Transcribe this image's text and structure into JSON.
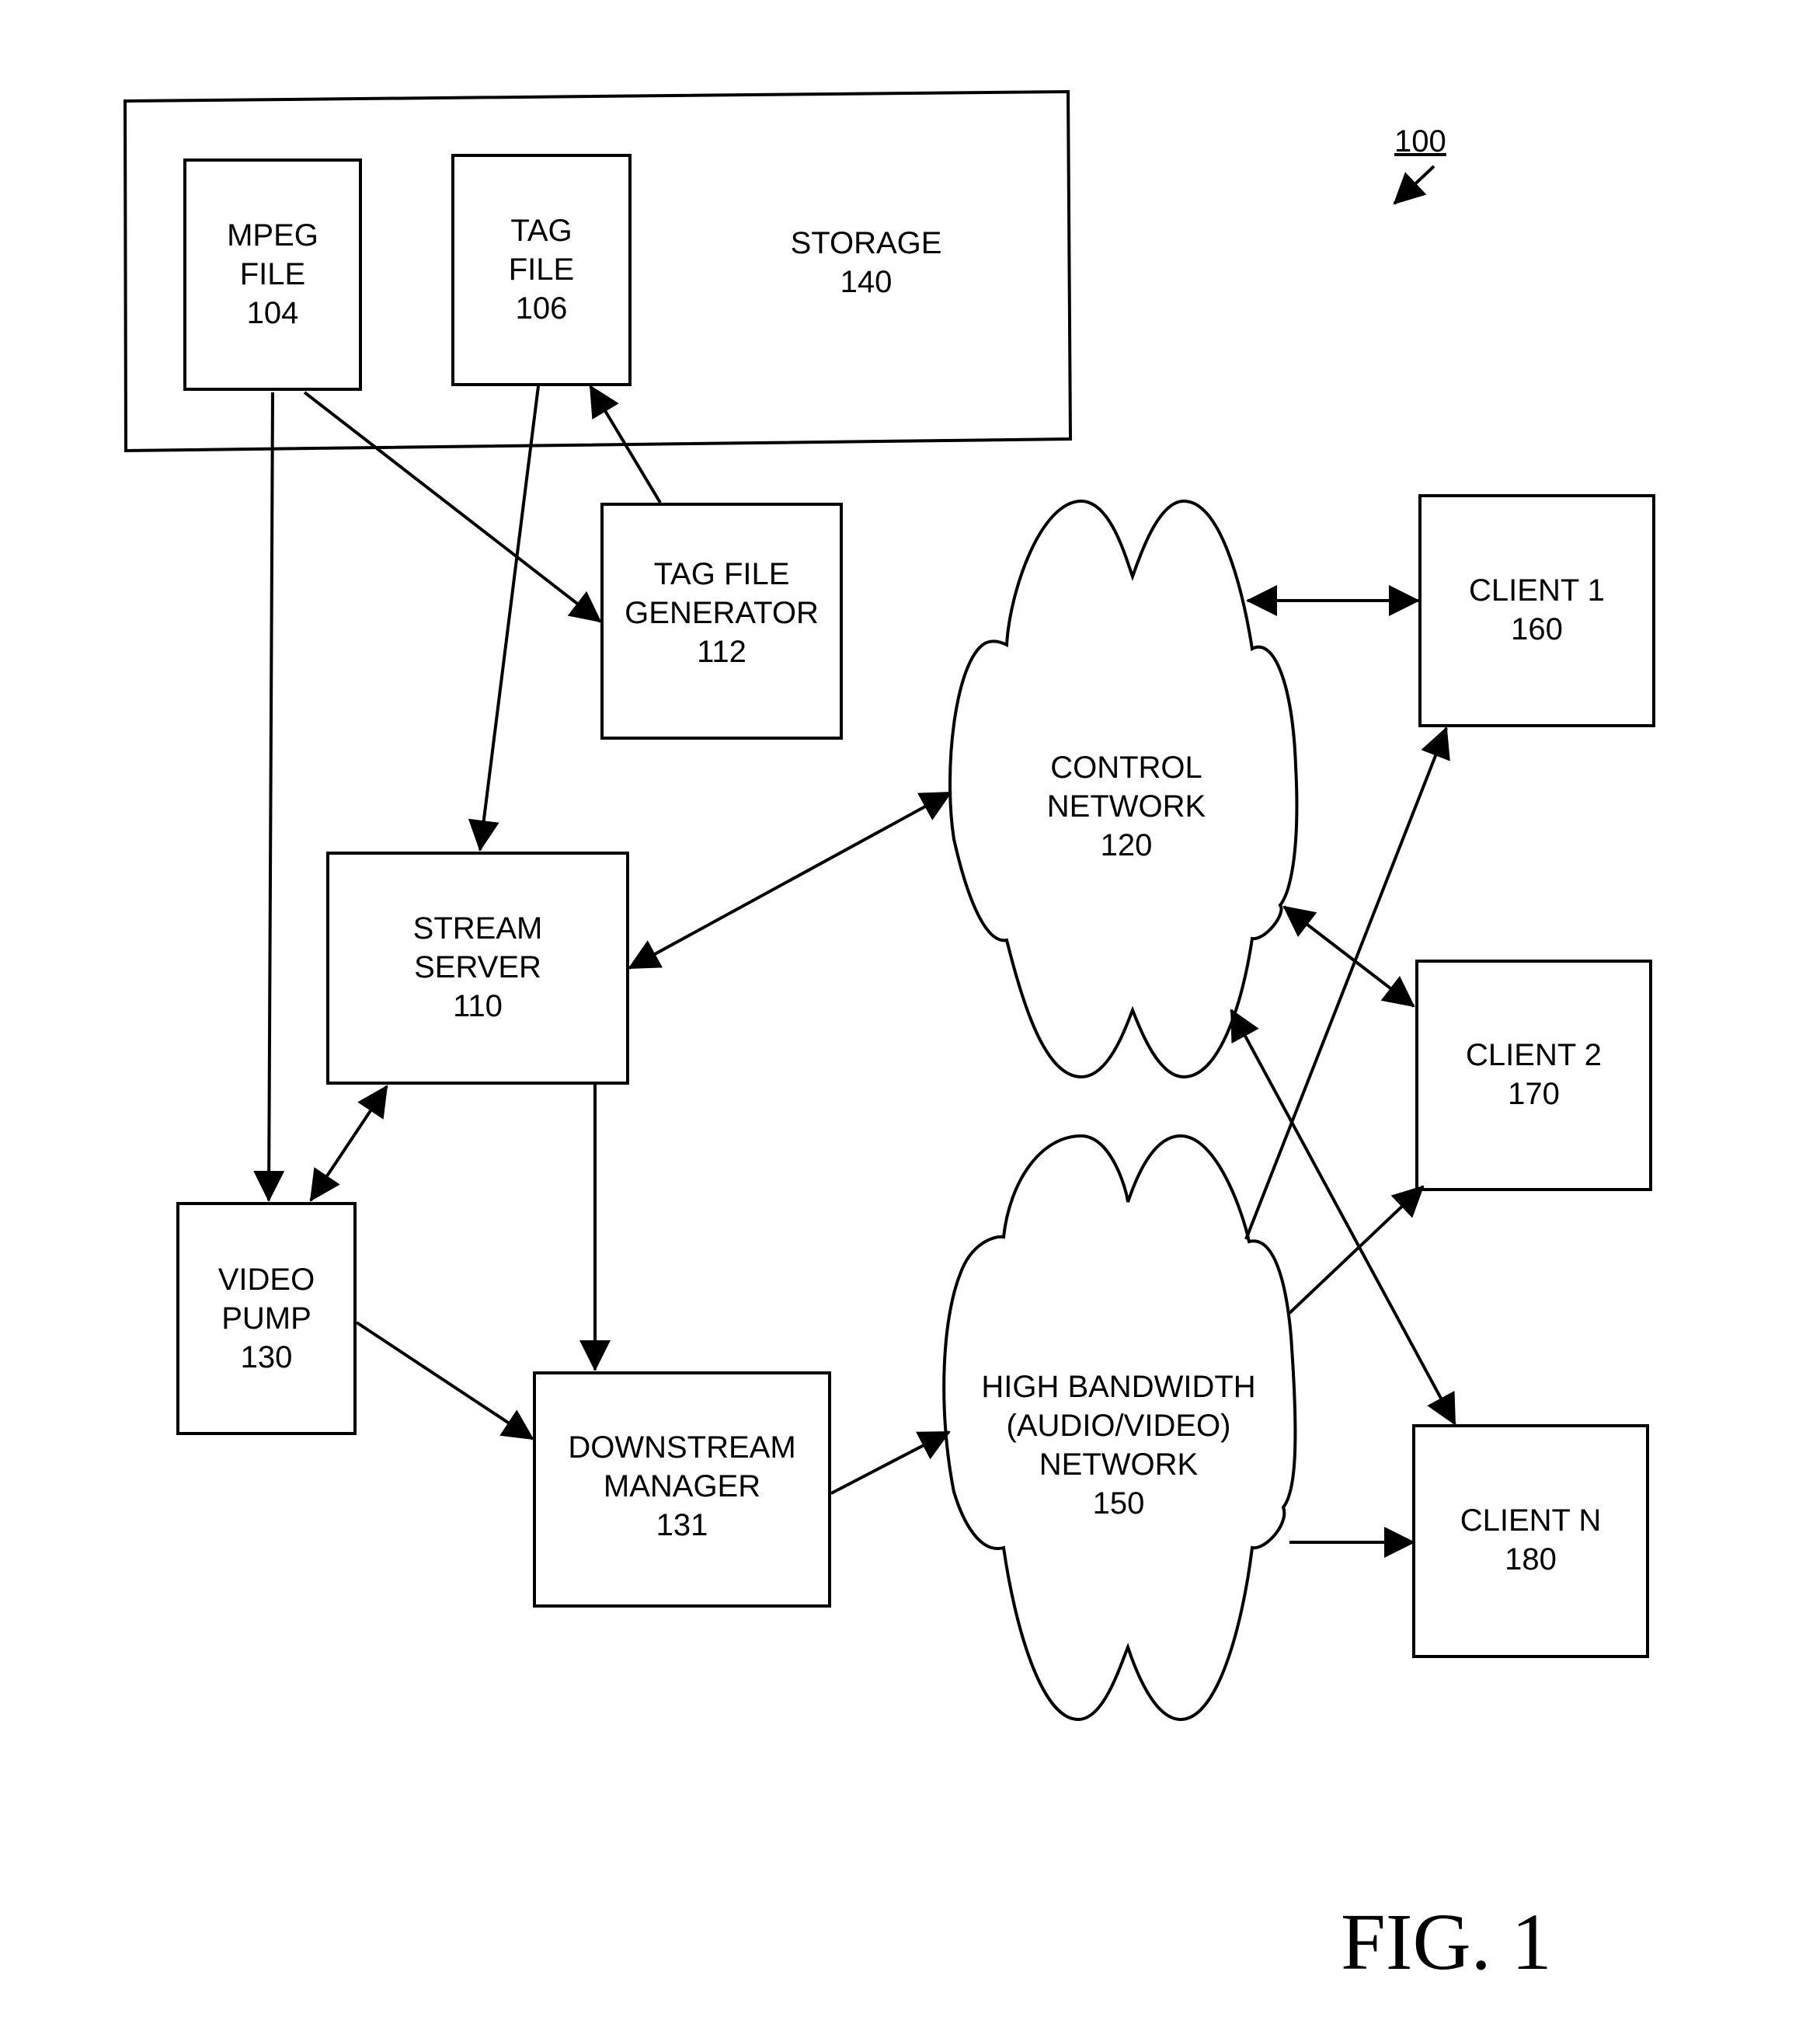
{
  "figure": {
    "reference_number": "100",
    "caption": "FIG. 1"
  },
  "nodes": {
    "storage": {
      "lines": [
        "STORAGE",
        "140"
      ]
    },
    "mpeg_file": {
      "lines": [
        "MPEG",
        "FILE",
        "104"
      ]
    },
    "tag_file": {
      "lines": [
        "TAG",
        "FILE",
        "106"
      ]
    },
    "tag_file_generator": {
      "lines": [
        "TAG FILE",
        "GENERATOR",
        "112"
      ]
    },
    "stream_server": {
      "lines": [
        "STREAM",
        "SERVER",
        "110"
      ]
    },
    "video_pump": {
      "lines": [
        "VIDEO",
        "PUMP",
        "130"
      ]
    },
    "downstream_manager": {
      "lines": [
        "DOWNSTREAM",
        "MANAGER",
        "131"
      ]
    },
    "control_network": {
      "lines": [
        "CONTROL",
        "NETWORK",
        "120"
      ]
    },
    "high_bandwidth_network": {
      "lines": [
        "HIGH BANDWIDTH",
        "(AUDIO/VIDEO)",
        "NETWORK",
        "150"
      ]
    },
    "client_1": {
      "lines": [
        "CLIENT 1",
        "160"
      ]
    },
    "client_2": {
      "lines": [
        "CLIENT 2",
        "170"
      ]
    },
    "client_n": {
      "lines": [
        "CLIENT N",
        "180"
      ]
    }
  },
  "edges": [
    {
      "from": "mpeg_file",
      "to": "video_pump",
      "direction": "forward"
    },
    {
      "from": "mpeg_file",
      "to": "tag_file_generator",
      "direction": "forward"
    },
    {
      "from": "tag_file_generator",
      "to": "tag_file",
      "direction": "forward"
    },
    {
      "from": "tag_file",
      "to": "stream_server",
      "direction": "forward"
    },
    {
      "from": "stream_server",
      "to": "control_network",
      "direction": "both"
    },
    {
      "from": "stream_server",
      "to": "video_pump",
      "direction": "both"
    },
    {
      "from": "stream_server",
      "to": "downstream_manager",
      "direction": "forward"
    },
    {
      "from": "video_pump",
      "to": "downstream_manager",
      "direction": "forward"
    },
    {
      "from": "downstream_manager",
      "to": "high_bandwidth_network",
      "direction": "forward"
    },
    {
      "from": "control_network",
      "to": "client_1",
      "direction": "both"
    },
    {
      "from": "control_network",
      "to": "client_2",
      "direction": "both"
    },
    {
      "from": "control_network",
      "to": "client_n",
      "direction": "both"
    },
    {
      "from": "high_bandwidth_network",
      "to": "client_1",
      "direction": "forward"
    },
    {
      "from": "high_bandwidth_network",
      "to": "client_2",
      "direction": "forward"
    },
    {
      "from": "high_bandwidth_network",
      "to": "client_n",
      "direction": "forward"
    }
  ]
}
